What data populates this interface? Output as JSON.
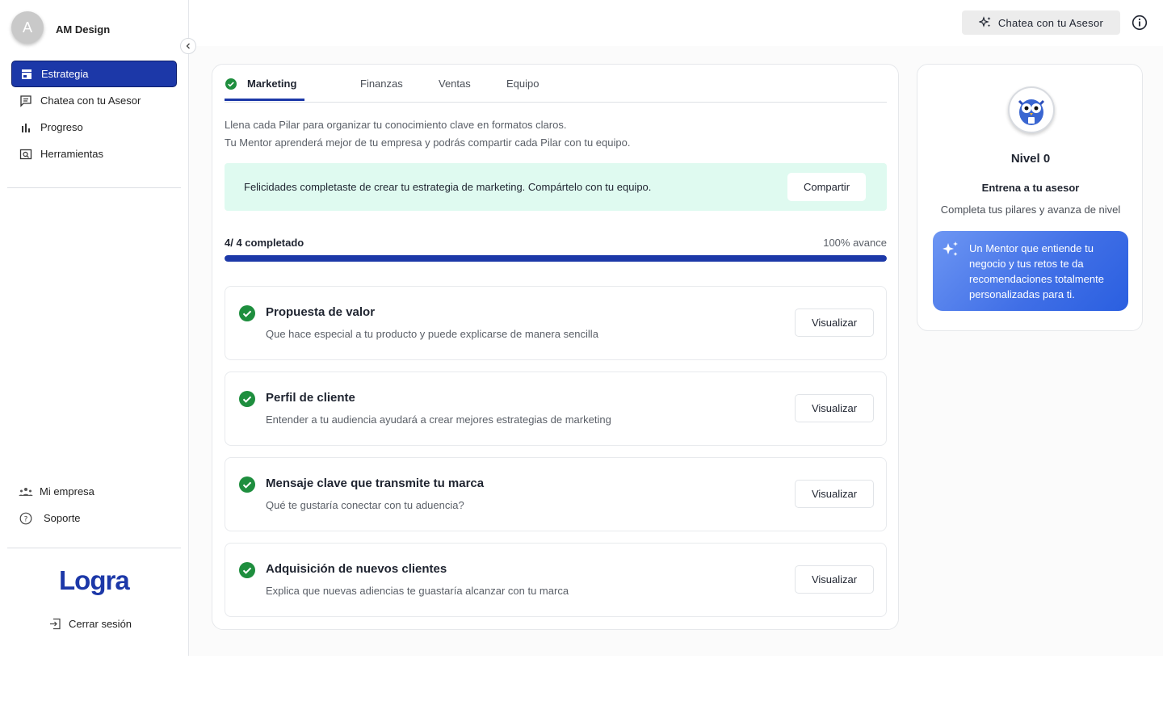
{
  "sidebar": {
    "profile": {
      "initial": "A",
      "name": "AM Design"
    },
    "items": [
      {
        "label": "Estrategia",
        "icon": "store-icon",
        "active": true
      },
      {
        "label": "Chatea con tu Asesor",
        "icon": "chat-icon",
        "active": false
      },
      {
        "label": "Progreso",
        "icon": "bar-chart-icon",
        "active": false
      },
      {
        "label": "Herramientas",
        "icon": "tools-icon",
        "active": false
      }
    ],
    "bottom_items": [
      {
        "label": "Mi empresa",
        "icon": "team-icon"
      },
      {
        "label": "Soporte",
        "icon": "help-circle-icon"
      }
    ],
    "logo_text": "Logra",
    "logout_label": "Cerrar sesión"
  },
  "topbar": {
    "chat_button_label": "Chatea con tu Asesor",
    "info_icon": "info-icon"
  },
  "main": {
    "tabs": [
      {
        "label": "Marketing",
        "active": true,
        "completed": true
      },
      {
        "label": "Finanzas",
        "active": false
      },
      {
        "label": "Ventas",
        "active": false
      },
      {
        "label": "Equipo",
        "active": false
      }
    ],
    "description_line1": "Llena cada Pilar para organizar tu conocimiento clave en formatos claros.",
    "description_line2": "Tu Mentor aprenderá mejor de tu empresa y podrás compartir cada Pilar con tu equipo.",
    "banner": {
      "text": "Felicidades completaste de crear tu estrategia de marketing. Compártelo con tu equipo.",
      "button_label": "Compartir"
    },
    "progress": {
      "count_label": "4/ 4 completado",
      "percent_label": "100% avance",
      "value": 1.0
    },
    "pillars": [
      {
        "title": "Propuesta de valor",
        "subtitle": "Que hace especial a tu producto y puede explicarse de manera sencilla",
        "button_label": "Visualizar"
      },
      {
        "title": "Perfil de cliente",
        "subtitle": "Entender a tu audiencia ayudará a crear mejores estrategias de marketing",
        "button_label": "Visualizar"
      },
      {
        "title": "Mensaje clave que transmite tu marca",
        "subtitle": "Qué te gustaría conectar con tu aduencia?",
        "button_label": "Visualizar"
      },
      {
        "title": "Adquisición de nuevos clientes",
        "subtitle": "Explica que nuevas adiencias te guastaría alcanzar con tu marca",
        "button_label": "Visualizar"
      }
    ]
  },
  "level_card": {
    "title": "Nivel 0",
    "subtitle": "Entrena a tu asesor",
    "description": "Completa tus pilares y avanza de nivel",
    "mentor_text": "Un Mentor que entiende tu negocio y tus retos te da recomendaciones totalmente personalizadas para ti.",
    "colors": {
      "gradient_start": "#6d96f3",
      "gradient_end": "#2a5fe0"
    }
  },
  "colors": {
    "brand": "#1c38a8",
    "success": "#1e8e3e",
    "banner_bg": "#dffaf0"
  }
}
